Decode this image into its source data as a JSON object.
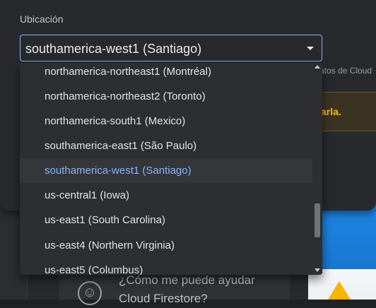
{
  "dialog": {
    "field_label": "Ubicación",
    "selected_value": "southamerica-west1 (Santiago)"
  },
  "background": {
    "cloud_text": "atos de Cloud",
    "warning_text": "arla.",
    "chat_line1": "¿Cómo me puede ayudar",
    "chat_line2": "Cloud Firestore?"
  },
  "dropdown": {
    "options": [
      {
        "label": "northamerica-northeast1 (Montréal)"
      },
      {
        "label": "northamerica-northeast2 (Toronto)"
      },
      {
        "label": "northamerica-south1 (Mexico)"
      },
      {
        "label": "southamerica-east1 (São Paulo)"
      },
      {
        "label": "southamerica-west1 (Santiago)",
        "selected": true
      },
      {
        "label": "us-central1 (Iowa)"
      },
      {
        "label": "us-east1 (South Carolina)"
      },
      {
        "label": "us-east4 (Northern Virginia)"
      },
      {
        "label": "us-east5 (Columbus)"
      }
    ]
  },
  "colors": {
    "accent": "#8ab4f8",
    "warning": "#fbbc04",
    "surface": "#27292d"
  }
}
